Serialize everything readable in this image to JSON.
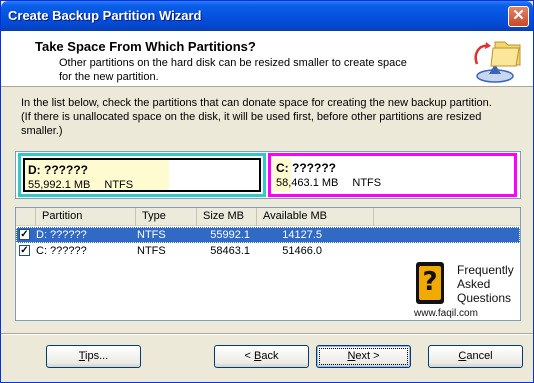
{
  "window": {
    "title": "Create Backup Partition Wizard",
    "close_glyph": "✕"
  },
  "header": {
    "title": "Take Space From Which Partitions?",
    "subtitle": "Other partitions on the hard disk can be resized smaller to create space for the new partition.",
    "icon": "folder-arrow-icon"
  },
  "description": {
    "line1": "In the list below, check the partitions that can donate space for creating the new backup partition.",
    "line2": "(If there is unallocated space on the disk, it will be used first, before other partitions are resized smaller.)"
  },
  "partitions_bar": [
    {
      "name": "D:  ??????",
      "size": "55,992.1 MB",
      "fs": "NTFS",
      "used_fraction": 0.6
    },
    {
      "name": "C:  ??????",
      "size": "58,463.1 MB",
      "fs": "NTFS",
      "used_fraction": 0.08
    }
  ],
  "table": {
    "columns": [
      "Partition",
      "Type",
      "Size MB",
      "Available MB"
    ],
    "rows": [
      {
        "checked": true,
        "partition": "D: ??????",
        "type": "NTFS",
        "size": "55992.1",
        "available": "14127.5",
        "selected": true
      },
      {
        "checked": true,
        "partition": "C: ??????",
        "type": "NTFS",
        "size": "58463.1",
        "available": "51466.0",
        "selected": false
      }
    ]
  },
  "watermark": {
    "line1": "Frequently",
    "line2": "Asked",
    "line3": "Questions",
    "url": "www.faqil.com",
    "logo_glyph": "?"
  },
  "buttons": {
    "tips": {
      "key": "T",
      "rest": "ips..."
    },
    "back": {
      "prefix": "< ",
      "key": "B",
      "rest": "ack"
    },
    "next": {
      "key": "N",
      "rest": "ext >"
    },
    "cancel": {
      "key": "C",
      "rest": "ancel"
    }
  },
  "colors": {
    "titlebar": "#0552de",
    "selected_row": "#316ac5",
    "d_border": "#32c8c8",
    "c_border": "#ff00ff"
  }
}
